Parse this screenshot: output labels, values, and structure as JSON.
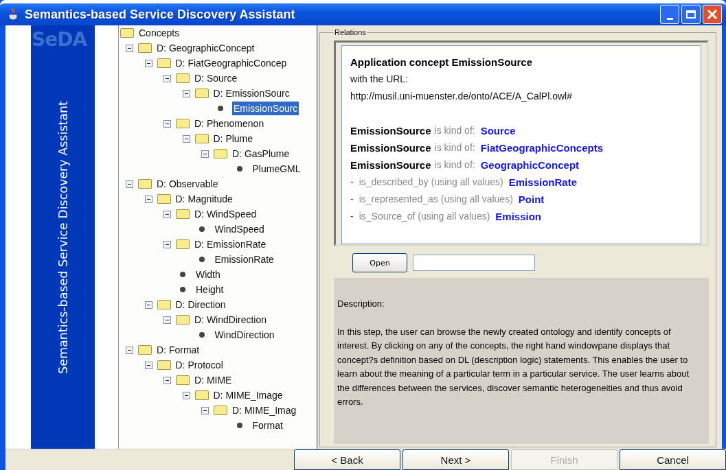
{
  "window": {
    "title": "Semantics-based Service Discovery Assistant"
  },
  "banner": {
    "logo": "SeDA",
    "caption": "Semantics-based Service Discovery Assistant"
  },
  "tree": {
    "label": "Concepts",
    "kind": "root",
    "children": [
      {
        "label": "D: GeographicConcept",
        "kind": "folder",
        "expanded": true,
        "selected": false,
        "children": [
          {
            "label": "D: FiatGeographicConcep",
            "kind": "folder",
            "expanded": true,
            "selected": false,
            "children": [
              {
                "label": "D: Source",
                "kind": "folder",
                "expanded": true,
                "selected": false,
                "children": [
                  {
                    "label": "D: EmissionSourc",
                    "kind": "folder",
                    "expanded": true,
                    "selected": false,
                    "children": [
                      {
                        "label": "EmissionSourc",
                        "kind": "leaf",
                        "selected": true
                      }
                    ]
                  }
                ]
              },
              {
                "label": "D: Phenomenon",
                "kind": "folder",
                "expanded": true,
                "selected": false,
                "children": [
                  {
                    "label": "D: Plume",
                    "kind": "folder",
                    "expanded": true,
                    "selected": false,
                    "children": [
                      {
                        "label": "D: GasPlume",
                        "kind": "folder",
                        "expanded": true,
                        "selected": false,
                        "children": [
                          {
                            "label": "PlumeGML",
                            "kind": "leaf",
                            "selected": false
                          }
                        ]
                      }
                    ]
                  }
                ]
              }
            ]
          }
        ]
      },
      {
        "label": "D: Observable",
        "kind": "folder",
        "expanded": true,
        "selected": false,
        "children": [
          {
            "label": "D: Magnitude",
            "kind": "folder",
            "expanded": true,
            "selected": false,
            "children": [
              {
                "label": "D: WindSpeed",
                "kind": "folder",
                "expanded": true,
                "selected": false,
                "children": [
                  {
                    "label": "WindSpeed",
                    "kind": "leaf",
                    "selected": false
                  }
                ]
              },
              {
                "label": "D: EmissionRate",
                "kind": "folder",
                "expanded": true,
                "selected": false,
                "children": [
                  {
                    "label": "EmissionRate",
                    "kind": "leaf",
                    "selected": false
                  }
                ]
              },
              {
                "label": "Width",
                "kind": "leaf",
                "selected": false
              },
              {
                "label": "Height",
                "kind": "leaf",
                "selected": false
              }
            ]
          },
          {
            "label": "D: Direction",
            "kind": "folder",
            "expanded": true,
            "selected": false,
            "children": [
              {
                "label": "D: WindDirection",
                "kind": "folder",
                "expanded": true,
                "selected": false,
                "children": [
                  {
                    "label": "WindDirection",
                    "kind": "leaf",
                    "selected": false
                  }
                ]
              }
            ]
          }
        ]
      },
      {
        "label": "D: Format",
        "kind": "folder",
        "expanded": true,
        "selected": false,
        "children": [
          {
            "label": "D: Protocol",
            "kind": "folder",
            "expanded": true,
            "selected": false,
            "children": [
              {
                "label": "D: MIME",
                "kind": "folder",
                "expanded": true,
                "selected": false,
                "children": [
                  {
                    "label": "D: MIME_Image",
                    "kind": "folder",
                    "expanded": true,
                    "selected": false,
                    "children": [
                      {
                        "label": "D: MIME_Imag",
                        "kind": "folder",
                        "expanded": true,
                        "selected": false,
                        "children": [
                          {
                            "label": "Format",
                            "kind": "leaf",
                            "selected": false
                          }
                        ]
                      }
                    ]
                  }
                ]
              }
            ]
          }
        ]
      }
    ]
  },
  "relations": {
    "legend": "Relations",
    "heading": "Application concept EmissionSource",
    "url_label": "with the URL:",
    "url": "http://musil.uni-muenster.de/onto/ACE/A_CalPl.owl#",
    "statements": [
      {
        "kind": "kind_of",
        "subject": "EmissionSource",
        "relation": "is kind of:",
        "object": "Source"
      },
      {
        "kind": "kind_of",
        "subject": "EmissionSource",
        "relation": "is kind of:",
        "object": "FiatGeographicConcepts"
      },
      {
        "kind": "kind_of",
        "subject": "EmissionSource",
        "relation": "is kind of:",
        "object": "GeographicConcept"
      },
      {
        "kind": "property",
        "marker": "-",
        "relation": "is_described_by (using all values)",
        "object": "EmissionRate"
      },
      {
        "kind": "property",
        "marker": "-",
        "relation": "is_represented_as (using all values)",
        "object": "Point"
      },
      {
        "kind": "property",
        "marker": "-",
        "relation": "is_Source_of (using all values)",
        "object": "Emission"
      }
    ],
    "open_button": "Open"
  },
  "description": {
    "label": "Description:",
    "text": "In this step, the user can browse the newly created ontology and identify concepts of interest. By clicking on any of the concepts, the right hand windowpane displays that concept?s definition based on DL (description logic) statements. This enables the user to learn about the meaning of a particular term in a particular service. The user learns about the differences between the services, discover semantic heterogeneities and thus avoid errors."
  },
  "buttons": [
    {
      "label": "< Back",
      "disabled": false
    },
    {
      "label": "Next >",
      "disabled": false
    },
    {
      "label": "Finish",
      "disabled": true
    },
    {
      "label": "Cancel",
      "disabled": false
    }
  ]
}
